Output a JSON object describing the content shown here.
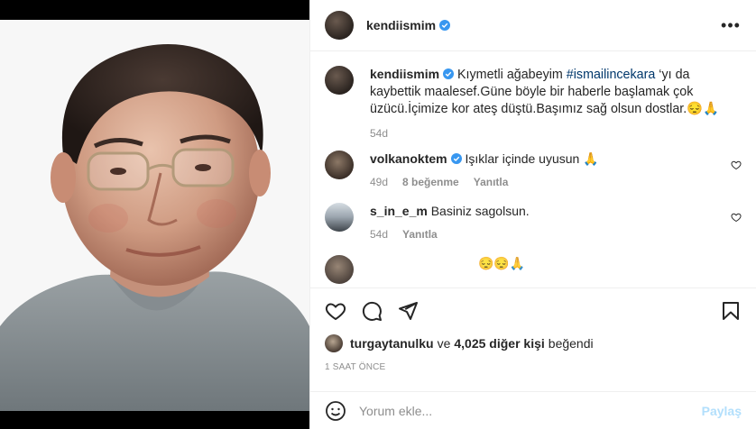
{
  "post": {
    "author": "kendiismim",
    "more_label": "•••"
  },
  "caption": {
    "username": "kendiismim",
    "text_before": "Kıymetli ağabeyim ",
    "hashtag": "#ismailincekara",
    "text_after": " ‘yı da kaybettik maalesef.Güne böyle bir haberle başlamak çok üzücü.İçimize kor ateş düştü.Başımız sağ olsun dostlar.😔🙏",
    "age": "54d"
  },
  "comments": [
    {
      "username": "volkanoktem",
      "verified": true,
      "text": "Işıklar içinde uyusun 🙏",
      "age": "49d",
      "likes": "8 beğenme",
      "reply": "Yanıtla"
    },
    {
      "username": "s_in_e_m",
      "verified": false,
      "text": "Basiniz sagolsun.",
      "age": "54d",
      "reply": "Yanıtla"
    }
  ],
  "partial_comment": {
    "text": "😔😔🙏"
  },
  "likes": {
    "first_user": "turgaytanulku",
    "conjunction": "ve",
    "others": "4,025 diğer kişi",
    "suffix": "beğendi"
  },
  "timestamp": "1 SAAT ÖNCE",
  "add_comment": {
    "placeholder": "Yorum ekle...",
    "post_label": "Paylaş"
  },
  "colors": {
    "verified_blue": "#3897f0",
    "hashtag": "#00376b",
    "muted": "#8e8e8e",
    "post_button_disabled": "#b2dffc"
  }
}
